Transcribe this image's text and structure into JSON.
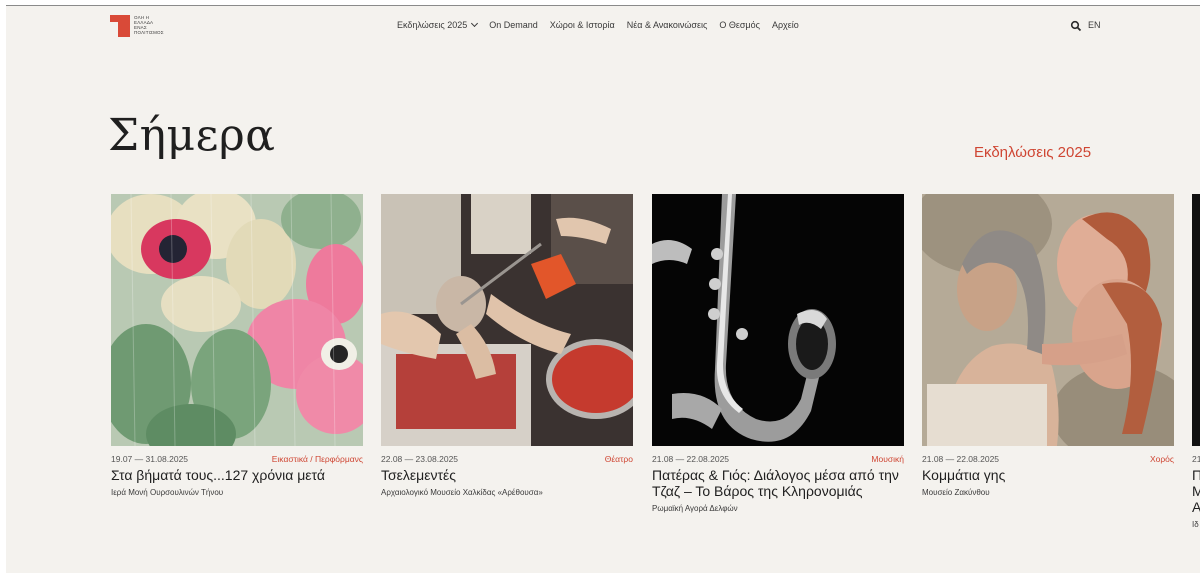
{
  "header": {
    "logo_lines": [
      "ΟΛΗ Η",
      "ΕΛΛΑΔΑ",
      "ΕΝΑΣ",
      "ΠΟΛΙΤΙΣΜΟΣ"
    ],
    "nav": [
      "Εκδηλώσεις 2025",
      "On Demand",
      "Χώροι & Ιστορία",
      "Νέα & Ανακοινώσεις",
      "Ο Θεσμός",
      "Αρχείο"
    ],
    "lang": "EN",
    "search_icon": "search-icon"
  },
  "main": {
    "title": "Σήμερα",
    "events_link": "Εκδηλώσεις 2025",
    "accent_color": "#cf4633"
  },
  "cards": [
    {
      "date": "19.07 — 31.08.2025",
      "category": "Εικαστικά / Περφόρμανς",
      "title": "Στα βήματά τους...127 χρόνια μετά",
      "venue": "Ιερά Μονή Ουρσουλινών Τήνου"
    },
    {
      "date": "22.08 — 23.08.2025",
      "category": "Θέατρο",
      "title": "Τσελεμεντές",
      "venue": "Αρχαιολογικό Μουσείο Χαλκίδας «Αρέθουσα»"
    },
    {
      "date": "21.08 — 22.08.2025",
      "category": "Μουσική",
      "title": "Πατέρας & Γιός: Διάλογος μέσα από την Τζαζ – Το Βάρος της Κληρονομιάς",
      "venue": "Ρωμαϊκή Αγορά Δελφών"
    },
    {
      "date": "21.08 — 22.08.2025",
      "category": "Χορός",
      "title": "Κομμάτια γης",
      "venue": "Μουσείο Ζακύνθου"
    },
    {
      "date": "21",
      "category": "",
      "title": "Π Μ Α",
      "venue": "Ιδ"
    }
  ]
}
